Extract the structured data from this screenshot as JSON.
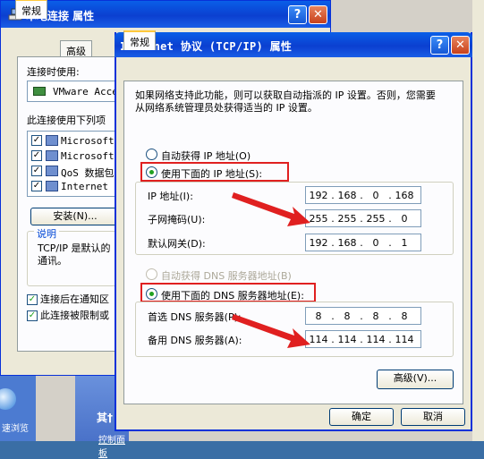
{
  "colors": {
    "title_bar": "#0b3fd0",
    "highlight_box": "#e02020",
    "arrow": "#e02020",
    "check": "#21a121"
  },
  "desktop": {
    "explorer_text": "其†",
    "explorer_sub": "控制面板",
    "left_icon_label": "速浏览"
  },
  "back_window": {
    "title": "本地连接 属性",
    "help_label": "?",
    "close_label": "✕",
    "tabs": [
      {
        "label": "常规"
      },
      {
        "label": "高级"
      }
    ],
    "connect_using_label": "连接时使用:",
    "adapter": "VMware Acce",
    "items_label": "此连接使用下列项",
    "items": [
      {
        "checked": "✓",
        "label": "Microsoft"
      },
      {
        "checked": "✓",
        "label": "Microsoft"
      },
      {
        "checked": "✓",
        "label": "QoS 数据包"
      },
      {
        "checked": "✓",
        "label": "Internet"
      }
    ],
    "install_button": "安装(N)...",
    "description_title": "说明",
    "description_text": "TCP/IP 是默认的通讯。",
    "check_notify": "连接后在通知区",
    "check_limited": "此连接被限制或",
    "check_mark": "✓"
  },
  "dialog": {
    "title": "Internet 协议 (TCP/IP) 属性",
    "help_label": "?",
    "close_label": "✕",
    "tab": "常规",
    "intro": "如果网络支持此功能，则可以获取自动指派的 IP 设置。否则，您需要从网络系统管理员处获得适当的 IP 设置。",
    "auto_ip_label": "自动获得 IP 地址(O)",
    "use_ip_label": "使用下面的 IP 地址(S):",
    "ip_address_label": "IP 地址(I):",
    "ip_address": [
      "192",
      "168",
      "0",
      "168"
    ],
    "subnet_label": "子网掩码(U):",
    "subnet": [
      "255",
      "255",
      "255",
      "0"
    ],
    "gateway_label": "默认网关(D):",
    "gateway": [
      "192",
      "168",
      "0",
      "1"
    ],
    "auto_dns_label": "自动获得 DNS 服务器地址(B)",
    "use_dns_label": "使用下面的 DNS 服务器地址(E):",
    "preferred_dns_label": "首选 DNS 服务器(P):",
    "preferred_dns": [
      "8",
      "8",
      "8",
      "8"
    ],
    "alternate_dns_label": "备用 DNS 服务器(A):",
    "alternate_dns": [
      "114",
      "114",
      "114",
      "114"
    ],
    "advanced_button": "高级(V)...",
    "ok_button": "确定",
    "cancel_button": "取消"
  }
}
